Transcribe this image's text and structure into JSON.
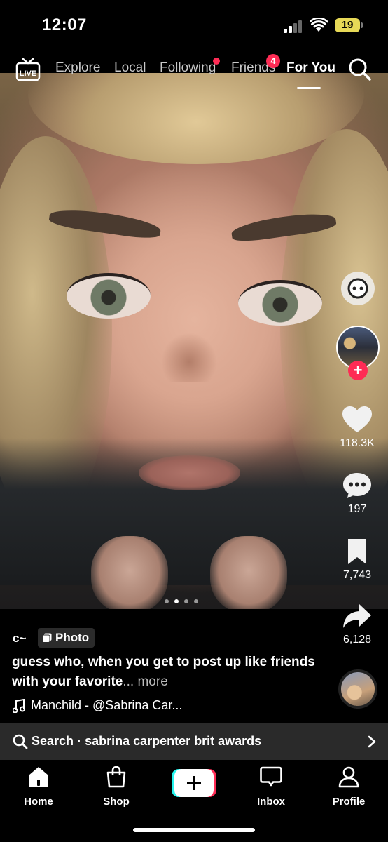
{
  "status_bar": {
    "time": "12:07",
    "battery": "19"
  },
  "top_nav": {
    "live_label": "LIVE",
    "tabs": [
      {
        "label": "Explore"
      },
      {
        "label": "Local"
      },
      {
        "label": "Following"
      },
      {
        "label": "Friends",
        "badge": "4"
      },
      {
        "label": "For You",
        "active": true
      }
    ]
  },
  "post": {
    "page_count": 4,
    "current_page": 2,
    "username": "c~",
    "type_badge": "Photo",
    "caption": "guess who, when you get to post up like friends with your favorite",
    "caption_more": "... more",
    "music": "Manchild - @Sabrina Car..."
  },
  "actions": {
    "likes": "118.3K",
    "comments": "197",
    "saves": "7,743",
    "shares": "6,128"
  },
  "search_suggestion": {
    "prefix": "Search",
    "separator": "·",
    "query": "sabrina carpenter brit awards"
  },
  "bottom_nav": {
    "items": [
      {
        "label": "Home",
        "icon": "home-icon"
      },
      {
        "label": "Shop",
        "icon": "shopping-bag-icon"
      },
      {
        "label": "",
        "icon": "create-plus-icon"
      },
      {
        "label": "Inbox",
        "icon": "inbox-icon"
      },
      {
        "label": "Profile",
        "icon": "profile-icon"
      }
    ]
  },
  "colors": {
    "accent": "#fe2c55",
    "battery": "#e7d957",
    "background": "#000000",
    "search_bar": "#2a2a2a"
  }
}
